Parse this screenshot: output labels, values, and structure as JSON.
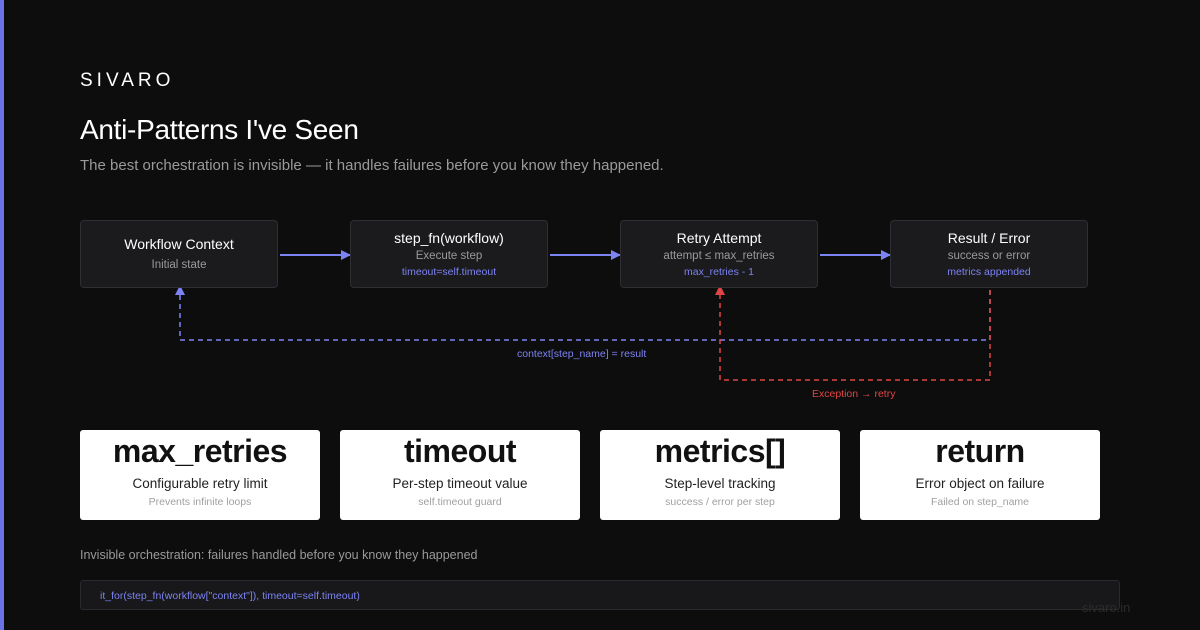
{
  "brand": "SIVARO",
  "title": "Anti-Patterns I've Seen",
  "subtitle": "The best orchestration is invisible — it handles failures before you know they happened.",
  "flow": {
    "nodes": [
      {
        "title": "Workflow Context",
        "sub": "Initial state",
        "note": ""
      },
      {
        "title": "step_fn(workflow)",
        "sub": "Execute step",
        "note": "timeout=self.timeout"
      },
      {
        "title": "Retry Attempt",
        "sub": "attempt ≤ max_retries",
        "note": "max_retries - 1"
      },
      {
        "title": "Result / Error",
        "sub": "success or error",
        "note": "metrics appended"
      }
    ],
    "success_loop_label": "context[step_name] = result",
    "retry_loop_label": "Exception → retry",
    "colors": {
      "primary": "#7c83f2",
      "error": "#e04545"
    }
  },
  "cards": [
    {
      "value": "max_retries",
      "label": "Configurable retry limit",
      "note": "Prevents infinite loops"
    },
    {
      "value": "timeout",
      "label": "Per-step timeout value",
      "note": "self.timeout guard"
    },
    {
      "value": "metrics[]",
      "label": "Step-level tracking",
      "note": "success / error per step"
    },
    {
      "value": "return",
      "label": "Error object on failure",
      "note": "Failed on step_name"
    }
  ],
  "footnote": "Invisible orchestration: failures handled before you know they happened",
  "code_snippet": "it_for(step_fn(workflow[\"context\"]), timeout=self.timeout)",
  "watermark": "sivaro.in"
}
